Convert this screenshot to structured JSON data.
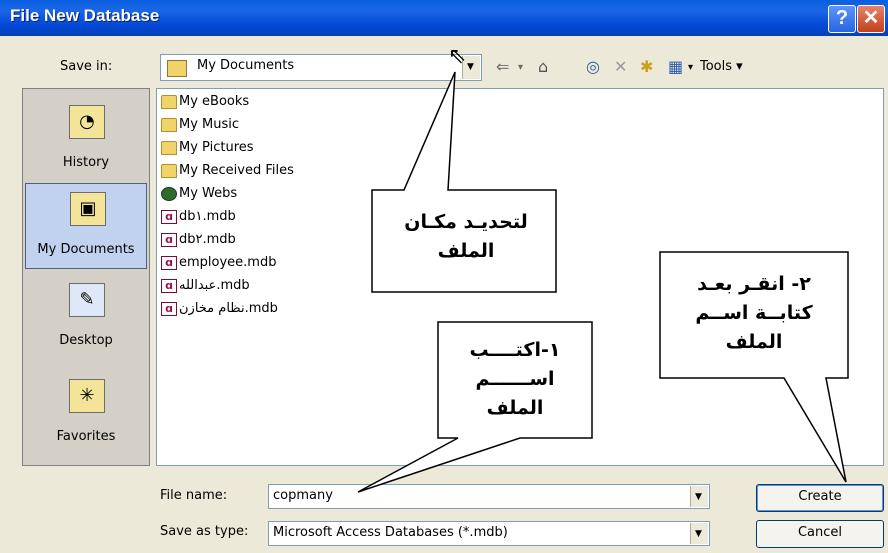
{
  "window": {
    "title": "File New Database",
    "help": "?",
    "close": "✕"
  },
  "save_in": {
    "label": "Save in:",
    "value": "My Documents",
    "tools_label": "Tools ▾"
  },
  "places": [
    {
      "label": "History",
      "icon": "history-icon",
      "glyph": "◔"
    },
    {
      "label": "My Documents",
      "icon": "my-documents-icon",
      "glyph": "▣"
    },
    {
      "label": "Desktop",
      "icon": "desktop-icon",
      "glyph": "✎"
    },
    {
      "label": "Favorites",
      "icon": "favorites-icon",
      "glyph": "✳"
    }
  ],
  "files": [
    {
      "name": "My eBooks",
      "type": "folder"
    },
    {
      "name": "My Music",
      "type": "folder"
    },
    {
      "name": "My Pictures",
      "type": "folder"
    },
    {
      "name": "My Received Files",
      "type": "folder"
    },
    {
      "name": "My Webs",
      "type": "web"
    },
    {
      "name": "db١.mdb",
      "type": "mdb"
    },
    {
      "name": "db٢.mdb",
      "type": "mdb"
    },
    {
      "name": "employee.mdb",
      "type": "mdb"
    },
    {
      "name": "عبدالله.mdb",
      "type": "mdb"
    },
    {
      "name": "نظام مخازن.mdb",
      "type": "mdb"
    }
  ],
  "file_name": {
    "label": "File name:",
    "value": "copmany"
  },
  "save_as_type": {
    "label": "Save as type:",
    "value": "Microsoft Access Databases (*.mdb)"
  },
  "buttons": {
    "create": "Create",
    "cancel": "Cancel"
  },
  "callouts": {
    "location": [
      "لتحديـد مكـان",
      "الملف"
    ],
    "step1": [
      "١-اكتــــب",
      "اســــــم",
      "الملف"
    ],
    "step2": [
      "٢- انقـر بعـد",
      "كتابــة اســم",
      "الملف"
    ]
  },
  "colors": {
    "title_bar": "#0349d6",
    "dialog_bg": "#ece9d8",
    "selected_place": "#c1d2ee"
  }
}
